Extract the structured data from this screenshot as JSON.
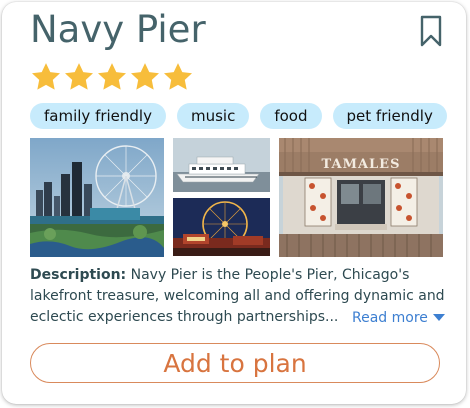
{
  "place": {
    "title": "Navy Pier",
    "rating": 5,
    "rating_max": 5
  },
  "tags": [
    "family friendly",
    "music",
    "food",
    "pet friendly"
  ],
  "description": {
    "label": "Description:",
    "lines": [
      " Navy Pier is the People's Pier, Chicago's",
      "lakefront treasure, welcoming all and offering dynamic and",
      "eclectic experiences through partnerships..."
    ]
  },
  "read_more": {
    "label": "Read more"
  },
  "photos": {
    "shop_sign": "TAMALES"
  },
  "actions": {
    "add_to_plan": "Add to plan"
  },
  "colors": {
    "title": "#45636a",
    "star": "#f7bd3b",
    "tag_bg": "#c7ebfc",
    "link": "#3d7fd1",
    "button_accent": "#d8743f"
  },
  "icons": {
    "bookmark": "bookmark-icon",
    "star": "star-icon",
    "caret": "chevron-down-icon"
  }
}
